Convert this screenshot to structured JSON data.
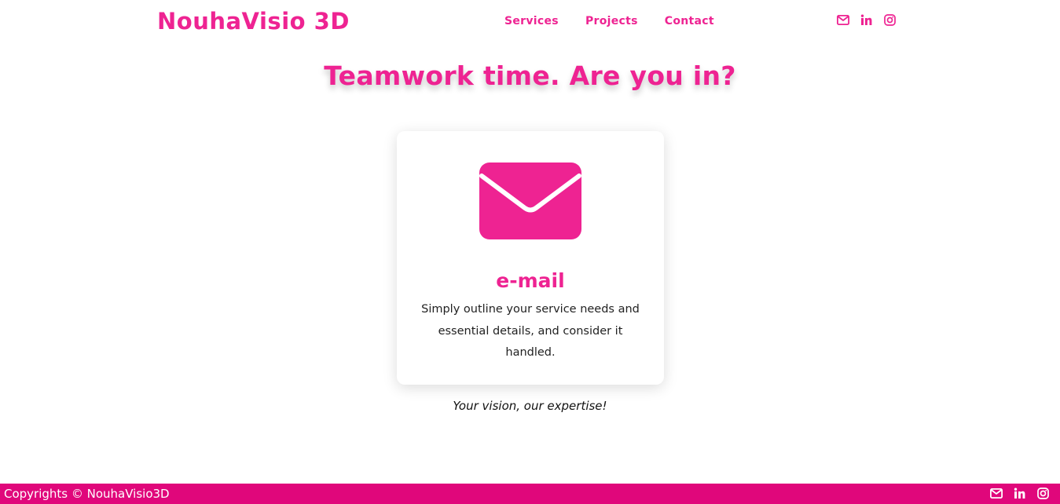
{
  "header": {
    "brand": "NouhaVisio 3D",
    "nav": [
      {
        "label": "Services"
      },
      {
        "label": "Projects"
      },
      {
        "label": "Contact"
      }
    ],
    "social_icons": [
      "envelope-icon",
      "linkedin-icon",
      "instagram-icon"
    ]
  },
  "main": {
    "headline": "Teamwork time. Are you in?",
    "card": {
      "icon": "envelope-icon",
      "title": "e-mail",
      "text": "Simply outline your service needs and essential details, and consider it handled."
    },
    "tagline": "Your vision, our expertise!"
  },
  "footer": {
    "copyright": "Copyrights © NouhaVisio3D",
    "social_icons": [
      "envelope-icon",
      "linkedin-icon",
      "instagram-icon"
    ]
  },
  "colors": {
    "accent": "#ee2392",
    "footer_bg": "#e0077b",
    "text": "#222222",
    "background": "#ffffff"
  }
}
